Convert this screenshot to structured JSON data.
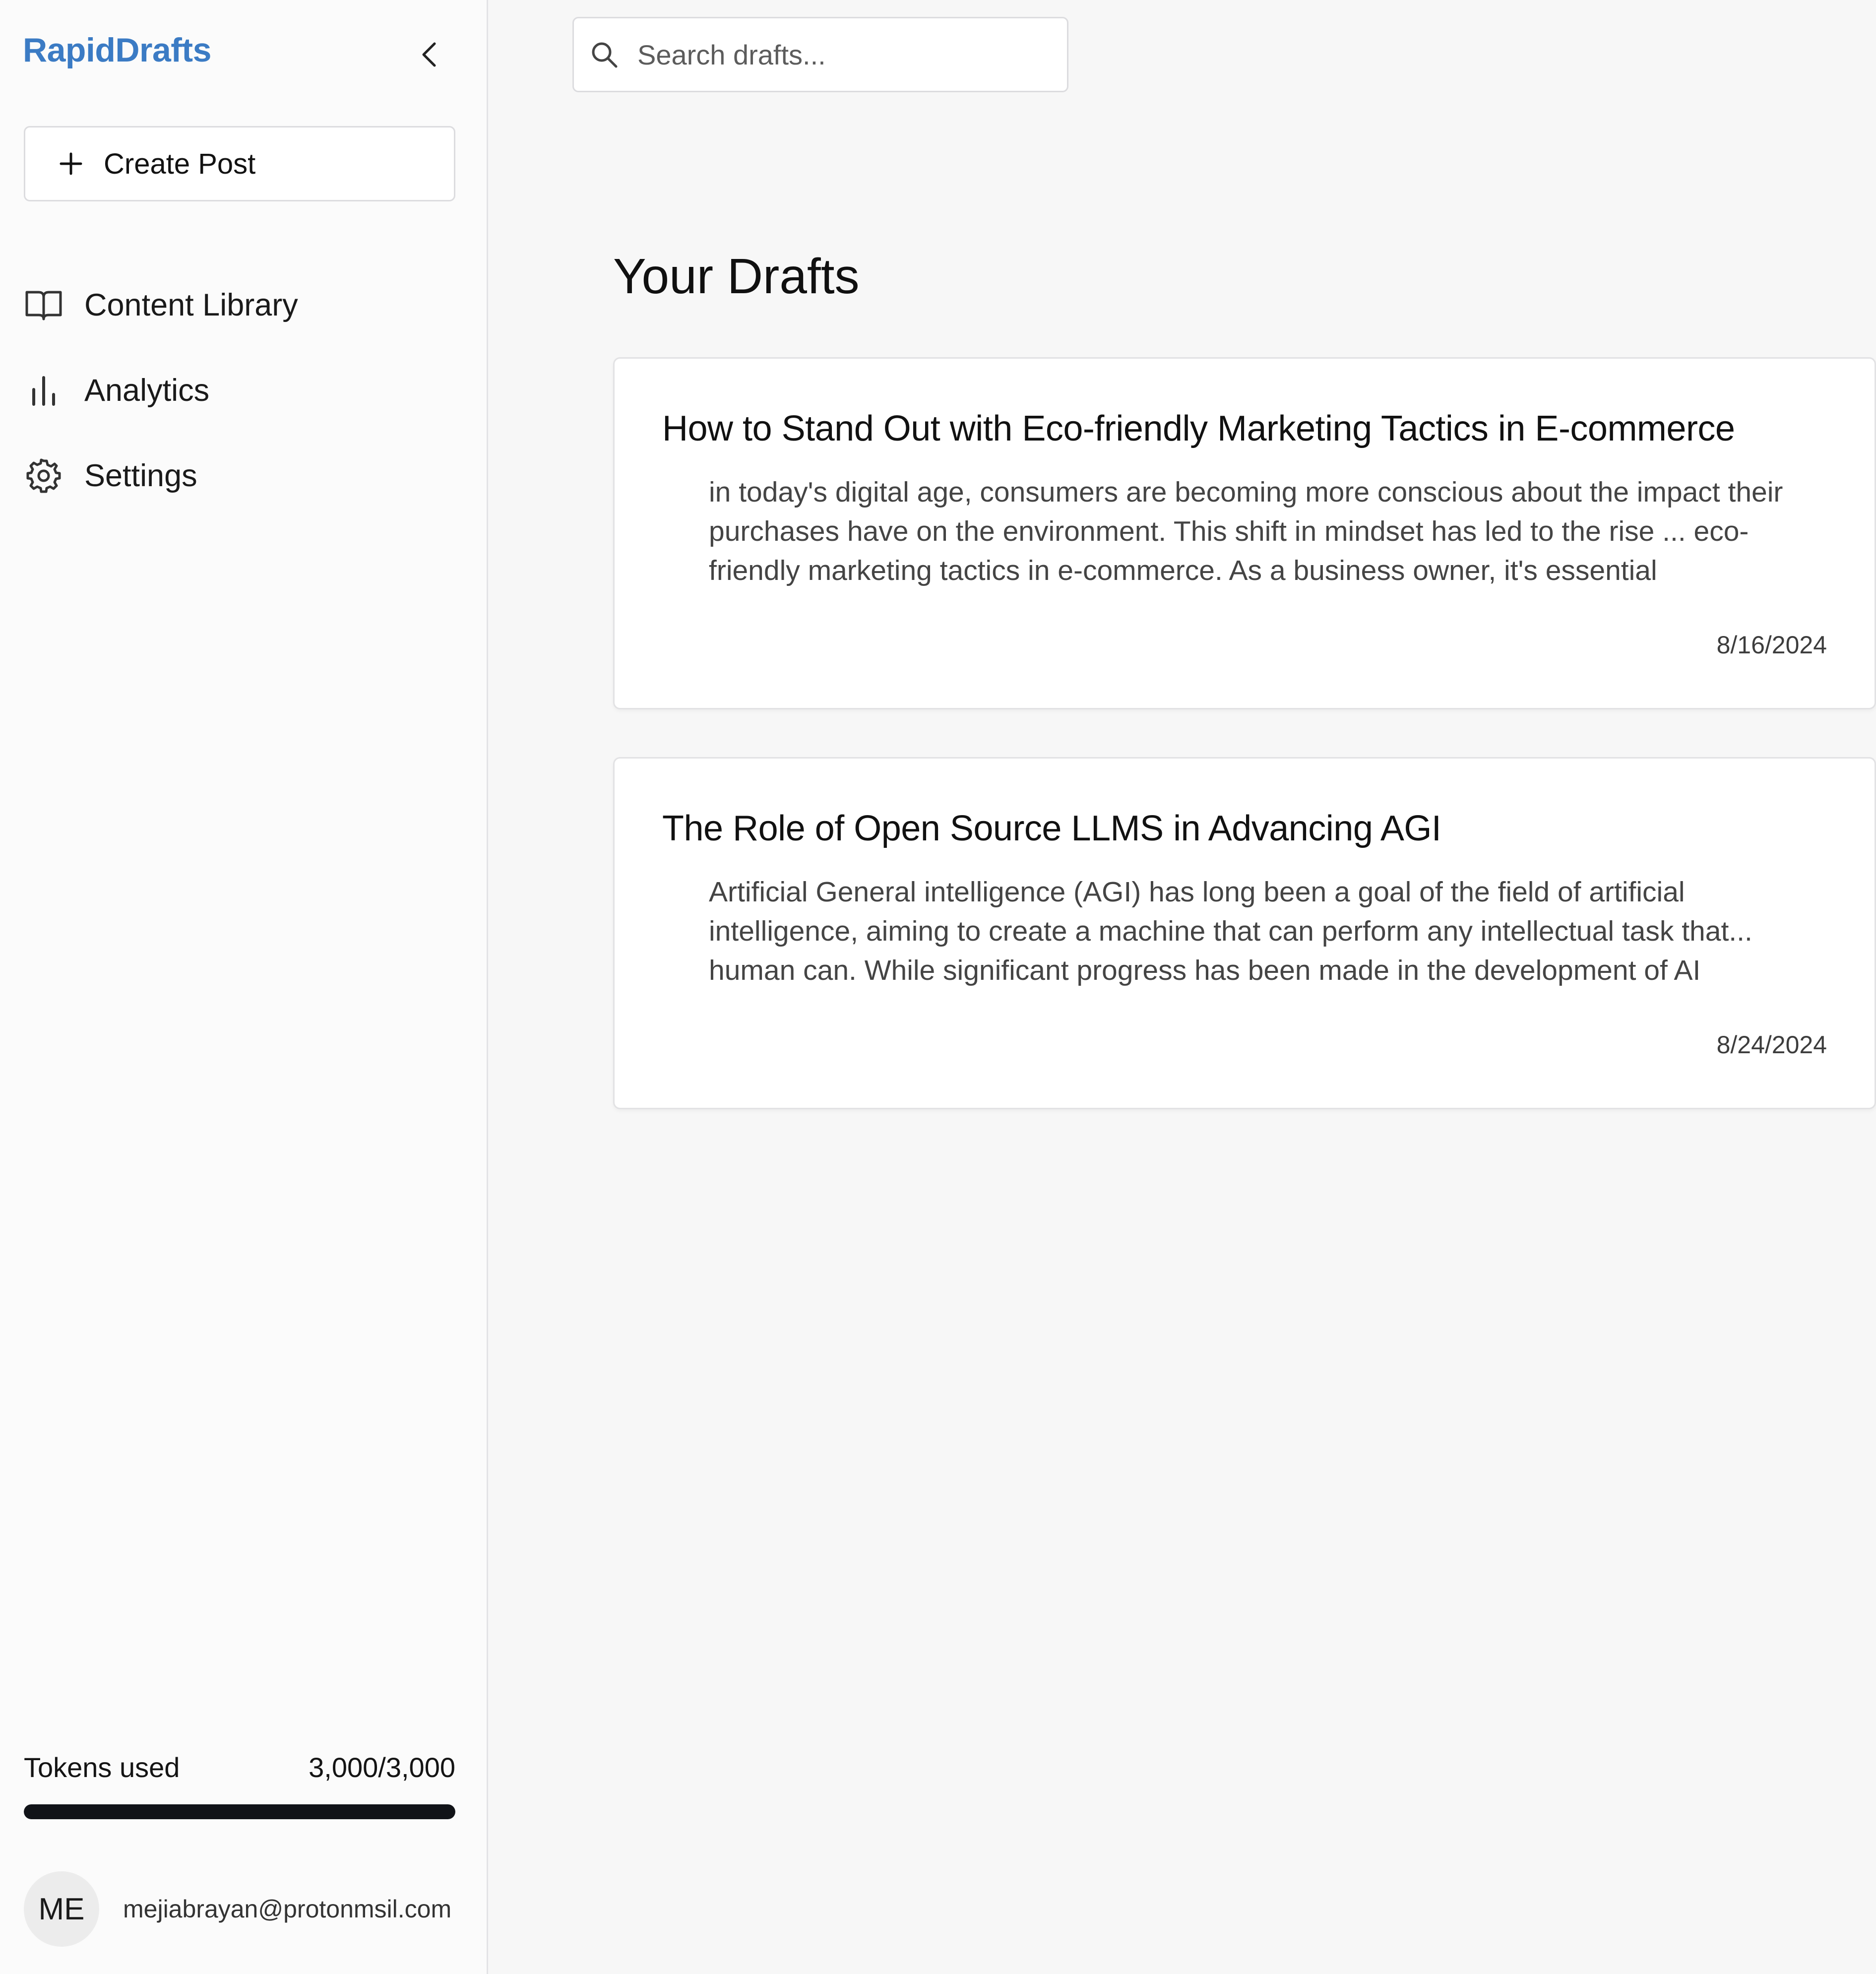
{
  "app": {
    "brand": "RapidDrafts",
    "brand_color": "#3b7bc4"
  },
  "sidebar": {
    "collapse_icon": "chevron-left-icon",
    "create_button": {
      "icon": "plus-icon",
      "label": "Create Post"
    },
    "nav": [
      {
        "icon": "book-open-icon",
        "label": "Content Library"
      },
      {
        "icon": "bar-chart-icon",
        "label": "Analytics"
      },
      {
        "icon": "gear-icon",
        "label": "Settings"
      }
    ],
    "tokens": {
      "label": "Tokens used",
      "value_text": "3,000/3,000",
      "used": 3000,
      "total": 3000,
      "fill_fraction": 1.0
    },
    "user": {
      "initials": "ME",
      "email": "mejiabrayan@protonmsil.com"
    }
  },
  "search": {
    "icon": "search-icon",
    "placeholder": "Search drafts...",
    "value": ""
  },
  "main": {
    "title": "Your Drafts",
    "drafts": [
      {
        "title": "How to Stand Out with Eco-friendly Marketing Tactics in E-commerce",
        "excerpt": "in today's digital age, consumers are becoming more conscious about the impact their purchases have on the environment. This shift in mindset has led to the rise ... eco-friendly marketing tactics in e-commerce. As a business owner, it's essential",
        "date": "8/16/2024"
      },
      {
        "title": "The Role of Open Source LLMS in Advancing AGI",
        "excerpt": "Artificial General intelligence (AGI) has long been a goal of the field of artificial intelligence, aiming to create a machine that can perform any intellectual task that... human can. While significant progress has been made in the development of AI",
        "date": "8/24/2024"
      }
    ]
  }
}
